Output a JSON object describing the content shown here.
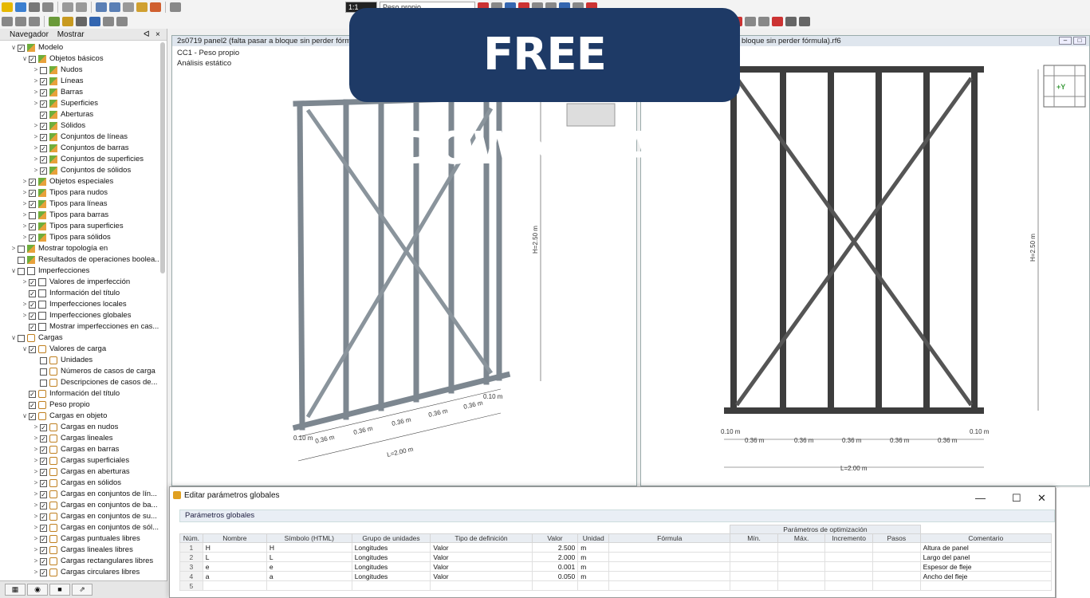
{
  "toolbar1": {
    "zoom": "1:1",
    "loadcase": "Peso propio"
  },
  "navigator": {
    "tabs": [
      "Navegador",
      "Mostrar"
    ],
    "pin": "ᐊ",
    "close": "×",
    "tree": [
      {
        "exp": "∨",
        "check": "☑",
        "icon": "model",
        "label": "Modelo",
        "level": 0
      },
      {
        "exp": "∨",
        "check": "☑",
        "icon": "model",
        "label": "Objetos básicos",
        "level": 1
      },
      {
        "exp": ">",
        "check": "☐",
        "icon": "model",
        "label": "Nudos",
        "level": 2
      },
      {
        "exp": ">",
        "check": "☑",
        "icon": "model",
        "label": "Líneas",
        "level": 2
      },
      {
        "exp": ">",
        "check": "☑",
        "icon": "model",
        "label": "Barras",
        "level": 2
      },
      {
        "exp": ">",
        "check": "☑",
        "icon": "model",
        "label": "Superficies",
        "level": 2
      },
      {
        "exp": "",
        "check": "☑",
        "icon": "model",
        "label": "Aberturas",
        "level": 2
      },
      {
        "exp": ">",
        "check": "☑",
        "icon": "model",
        "label": "Sólidos",
        "level": 2
      },
      {
        "exp": ">",
        "check": "☑",
        "icon": "model",
        "label": "Conjuntos de líneas",
        "level": 2
      },
      {
        "exp": ">",
        "check": "☑",
        "icon": "model",
        "label": "Conjuntos de barras",
        "level": 2
      },
      {
        "exp": ">",
        "check": "☑",
        "icon": "model",
        "label": "Conjuntos de superficies",
        "level": 2
      },
      {
        "exp": ">",
        "check": "☑",
        "icon": "model",
        "label": "Conjuntos de sólidos",
        "level": 2
      },
      {
        "exp": ">",
        "check": "☑",
        "icon": "model",
        "label": "Objetos especiales",
        "level": 1
      },
      {
        "exp": ">",
        "check": "☑",
        "icon": "model",
        "label": "Tipos para nudos",
        "level": 1
      },
      {
        "exp": ">",
        "check": "☑",
        "icon": "model",
        "label": "Tipos para líneas",
        "level": 1
      },
      {
        "exp": ">",
        "check": "☐",
        "icon": "model",
        "label": "Tipos para barras",
        "level": 1
      },
      {
        "exp": ">",
        "check": "☑",
        "icon": "model",
        "label": "Tipos para superficies",
        "level": 1
      },
      {
        "exp": ">",
        "check": "☑",
        "icon": "model",
        "label": "Tipos para sólidos",
        "level": 1
      },
      {
        "exp": ">",
        "check": "☐",
        "icon": "model",
        "label": "Mostrar topología en",
        "level": 0
      },
      {
        "exp": "",
        "check": "☐",
        "icon": "model",
        "label": "Resultados de operaciones boolea...",
        "level": 0
      },
      {
        "exp": "∨",
        "check": "☐",
        "icon": "imp",
        "label": "Imperfecciones",
        "level": 0
      },
      {
        "exp": ">",
        "check": "☑",
        "icon": "imp",
        "label": "Valores de imperfección",
        "level": 1
      },
      {
        "exp": "",
        "check": "☑",
        "icon": "imp",
        "label": "Información del título",
        "level": 1
      },
      {
        "exp": ">",
        "check": "☑",
        "icon": "imp",
        "label": "Imperfecciones locales",
        "level": 1
      },
      {
        "exp": ">",
        "check": "☑",
        "icon": "imp",
        "label": "Imperfecciones globales",
        "level": 1
      },
      {
        "exp": "",
        "check": "☑",
        "icon": "imp",
        "label": "Mostrar imperfecciones en cas...",
        "level": 1
      },
      {
        "exp": "∨",
        "check": "☐",
        "icon": "load",
        "label": "Cargas",
        "level": 0
      },
      {
        "exp": "∨",
        "check": "☑",
        "icon": "load",
        "label": "Valores de carga",
        "level": 1
      },
      {
        "exp": "",
        "check": "☐",
        "icon": "load",
        "label": "Unidades",
        "level": 2
      },
      {
        "exp": "",
        "check": "☐",
        "icon": "load",
        "label": "Números de casos de carga",
        "level": 2
      },
      {
        "exp": "",
        "check": "☐",
        "icon": "load",
        "label": "Descripciones de casos de...",
        "level": 2
      },
      {
        "exp": "",
        "check": "☑",
        "icon": "load",
        "label": "Información del título",
        "level": 1
      },
      {
        "exp": "",
        "check": "☑",
        "icon": "load",
        "label": "Peso propio",
        "level": 1
      },
      {
        "exp": "∨",
        "check": "☑",
        "icon": "load",
        "label": "Cargas en objeto",
        "level": 1
      },
      {
        "exp": ">",
        "check": "☑",
        "icon": "load",
        "label": "Cargas en nudos",
        "level": 2
      },
      {
        "exp": ">",
        "check": "☑",
        "icon": "load",
        "label": "Cargas lineales",
        "level": 2
      },
      {
        "exp": ">",
        "check": "☑",
        "icon": "load",
        "label": "Cargas en barras",
        "level": 2
      },
      {
        "exp": ">",
        "check": "☑",
        "icon": "load",
        "label": "Cargas superficiales",
        "level": 2
      },
      {
        "exp": ">",
        "check": "☑",
        "icon": "load",
        "label": "Cargas en aberturas",
        "level": 2
      },
      {
        "exp": ">",
        "check": "☑",
        "icon": "load",
        "label": "Cargas en sólidos",
        "level": 2
      },
      {
        "exp": ">",
        "check": "☑",
        "icon": "load",
        "label": "Cargas en conjuntos de lín...",
        "level": 2
      },
      {
        "exp": ">",
        "check": "☑",
        "icon": "load",
        "label": "Cargas en conjuntos de ba...",
        "level": 2
      },
      {
        "exp": ">",
        "check": "☑",
        "icon": "load",
        "label": "Cargas en conjuntos de su...",
        "level": 2
      },
      {
        "exp": ">",
        "check": "☑",
        "icon": "load",
        "label": "Cargas en conjuntos de sól...",
        "level": 2
      },
      {
        "exp": ">",
        "check": "☑",
        "icon": "load",
        "label": "Cargas puntuales libres",
        "level": 2
      },
      {
        "exp": ">",
        "check": "☑",
        "icon": "load",
        "label": "Cargas lineales libres",
        "level": 2
      },
      {
        "exp": ">",
        "check": "☑",
        "icon": "load",
        "label": "Cargas rectangulares libres",
        "level": 2
      },
      {
        "exp": ">",
        "check": "☑",
        "icon": "load",
        "label": "Cargas circulares libres",
        "level": 2
      }
    ]
  },
  "view_left": {
    "title": "2s0719 panel2 (falta pasar a bloque sin perder fórmula",
    "lc": "CC1 - Peso propio",
    "analysis": "Análisis estático",
    "dim_h": "H=2.50 m",
    "dim_total": "L=2.00 m",
    "dim_edge": "0.10 m",
    "dim_seg": "0.36 m"
  },
  "view_right": {
    "title": "bloque sin perder fórmula).rf6",
    "dim_h": "H=2.50 m",
    "dim_total": "L=2.00 m",
    "dim_edge": "0.10 m",
    "dim_seg": "0.36 m",
    "axis": "+Y"
  },
  "banner": "FREE DOWNLOAD",
  "dialog": {
    "title": "Editar parámetros globales",
    "section": "Parámetros globales",
    "opt_group": "Parámetros de optimización",
    "headers": [
      "Núm.",
      "Nombre",
      "Símbolo (HTML)",
      "Grupo de unidades",
      "Tipo de definición",
      "Valor",
      "Unidad",
      "Fórmula",
      "Mín.",
      "Máx.",
      "Incremento",
      "Pasos",
      "Comentario"
    ],
    "rows": [
      [
        "1",
        "H",
        "H",
        "Longitudes",
        "Valor",
        "2.500",
        "m",
        "",
        "",
        "",
        "",
        "",
        "Altura de panel"
      ],
      [
        "2",
        "L",
        "L",
        "Longitudes",
        "Valor",
        "2.000",
        "m",
        "",
        "",
        "",
        "",
        "",
        "Largo del panel"
      ],
      [
        "3",
        "e",
        "e",
        "Longitudes",
        "Valor",
        "0.001",
        "m",
        "",
        "",
        "",
        "",
        "",
        "Espesor de fleje"
      ],
      [
        "4",
        "a",
        "a",
        "Longitudes",
        "Valor",
        "0.050",
        "m",
        "",
        "",
        "",
        "",
        "",
        "Ancho del fleje"
      ],
      [
        "5",
        "",
        "",
        "",
        "",
        "",
        "",
        "",
        "",
        "",
        "",
        "",
        ""
      ]
    ]
  },
  "colors": {
    "banner": "#1e3a66",
    "accent": "#1e3a66"
  }
}
